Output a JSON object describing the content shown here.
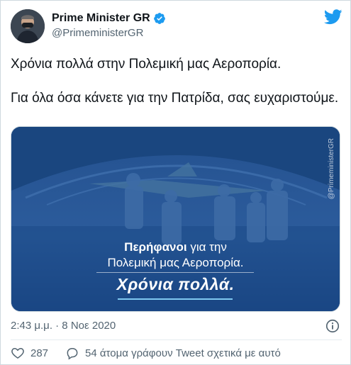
{
  "author": {
    "display_name": "Prime Minister GR",
    "handle": "@PrimeministerGR"
  },
  "tweet": {
    "paragraphs": [
      "Χρόνια πολλά στην Πολεμική μας Αεροπορία.",
      "Για όλα όσα κάνετε για την Πατρίδα, σας ευχαριστούμε."
    ]
  },
  "media": {
    "watermark": "@PrimeministerGR",
    "caption_bold": "Περήφανοι",
    "caption_rest": " για την",
    "caption_line2": "Πολεμική μας Αεροπορία.",
    "caption_line3": "Χρόνια πολλά."
  },
  "meta": {
    "timestamp": "2:43 μ.μ. · 8 Νοε 2020"
  },
  "actions": {
    "likes": "287",
    "talking": "54 άτομα γράφουν Tweet σχετικά με αυτό"
  },
  "colors": {
    "twitter_blue": "#1d9bf0",
    "like_red": "#f91880",
    "media_blue": "#1f4f8f"
  }
}
